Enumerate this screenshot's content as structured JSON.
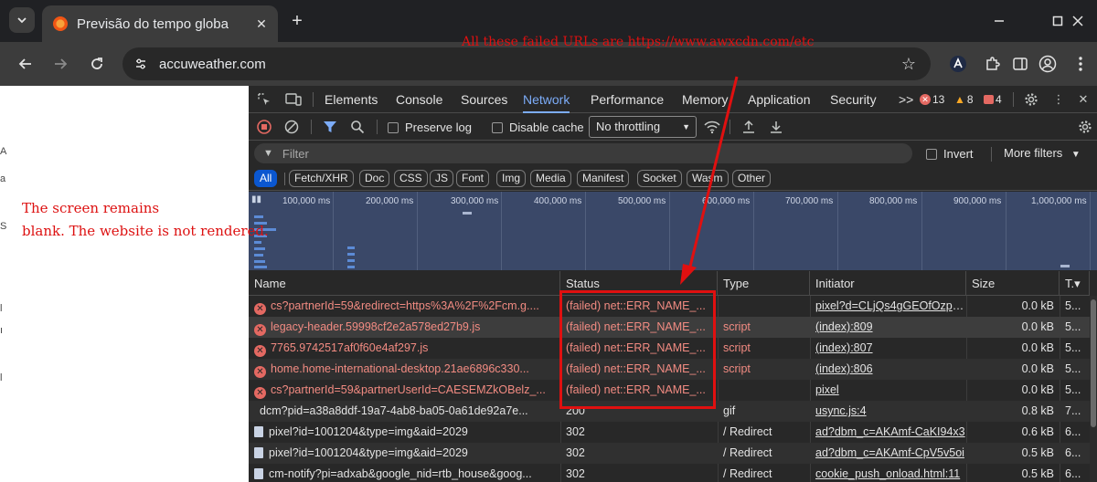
{
  "browser": {
    "tab_title": "Previsão do tempo globa",
    "url": "accuweather.com"
  },
  "page": {
    "edge_text": [
      "A",
      "a",
      "S",
      "l",
      "ı",
      "l"
    ]
  },
  "devtools": {
    "tabs": [
      "Elements",
      "Console",
      "Sources",
      "Network",
      "Performance",
      "Memory",
      "Application",
      "Security"
    ],
    "active_tab": "Network",
    "more_tabs": ">>",
    "error_count": "13",
    "warning_count": "8",
    "issue_count": "4"
  },
  "network": {
    "preserve_log": "Preserve log",
    "disable_cache": "Disable cache",
    "throttling": "No throttling",
    "filter_placeholder": "Filter",
    "invert": "Invert",
    "more_filters": "More filters",
    "type_filters": [
      "All",
      "Fetch/XHR",
      "Doc",
      "CSS",
      "JS",
      "Font",
      "Img",
      "Media",
      "Manifest",
      "Socket",
      "Wasm",
      "Other"
    ],
    "timeline_ticks": [
      "100,000 ms",
      "200,000 ms",
      "300,000 ms",
      "400,000 ms",
      "500,000 ms",
      "600,000 ms",
      "700,000 ms",
      "800,000 ms",
      "900,000 ms",
      "1,000,000 ms"
    ],
    "columns": [
      "Name",
      "Status",
      "Type",
      "Initiator",
      "Size",
      "T.▾"
    ],
    "rows": [
      {
        "name": "cs?partnerId=59&redirect=https%3A%2F%2Fcm.g....",
        "status": "(failed) net::ERR_NAME_...",
        "type": "",
        "initiator": "pixel?d=CLjQs4gGEOfOzpwC",
        "size": "0.0 kB",
        "time": "5...",
        "failed": true
      },
      {
        "name": "legacy-header.59998cf2e2a578ed27b9.js",
        "status": "(failed) net::ERR_NAME_...",
        "type": "script",
        "initiator": "(index):809",
        "size": "0.0 kB",
        "time": "5...",
        "failed": true
      },
      {
        "name": "7765.9742517af0f60e4af297.js",
        "status": "(failed) net::ERR_NAME_...",
        "type": "script",
        "initiator": "(index):807",
        "size": "0.0 kB",
        "time": "5...",
        "failed": true
      },
      {
        "name": "home.home-international-desktop.21ae6896c330...",
        "status": "(failed) net::ERR_NAME_...",
        "type": "script",
        "initiator": "(index):806",
        "size": "0.0 kB",
        "time": "5...",
        "failed": true
      },
      {
        "name": "cs?partnerId=59&partnerUserId=CAESEMZkOBelz_...",
        "status": "(failed) net::ERR_NAME_...",
        "type": "",
        "initiator": "pixel",
        "size": "0.0 kB",
        "time": "5...",
        "failed": true
      },
      {
        "name": "dcm?pid=a38a8ddf-19a7-4ab8-ba05-0a61de92a7e...",
        "status": "200",
        "type": "gif",
        "initiator": "usync.js:4",
        "size": "0.8 kB",
        "time": "7...",
        "failed": false
      },
      {
        "name": "pixel?id=1001204&type=img&aid=2029",
        "status": "302",
        "type": "/ Redirect",
        "initiator": "ad?dbm_c=AKAmf-CaKI94x3",
        "size": "0.6 kB",
        "time": "6...",
        "failed": false
      },
      {
        "name": "pixel?id=1001204&type=img&aid=2029",
        "status": "302",
        "type": "/ Redirect",
        "initiator": "ad?dbm_c=AKAmf-CpV5v5oi",
        "size": "0.5 kB",
        "time": "6...",
        "failed": false
      },
      {
        "name": "cm-notify?pi=adxab&google_nid=rtb_house&goog...",
        "status": "302",
        "type": "/ Redirect",
        "initiator": "cookie_push_onload.html:11",
        "size": "0.5 kB",
        "time": "6...",
        "failed": false
      }
    ]
  },
  "annotations": {
    "failed_urls": "All these failed URLs are https://www.awxcdn.com/etc",
    "blank_line1": "The screen remains",
    "blank_line2": "blank. The website is not rendered."
  },
  "colors": {
    "annotation_red": "#e01010",
    "devtools_bg": "#282828",
    "active_tab_blue": "#7cacf8",
    "error_red": "#f28b82"
  }
}
